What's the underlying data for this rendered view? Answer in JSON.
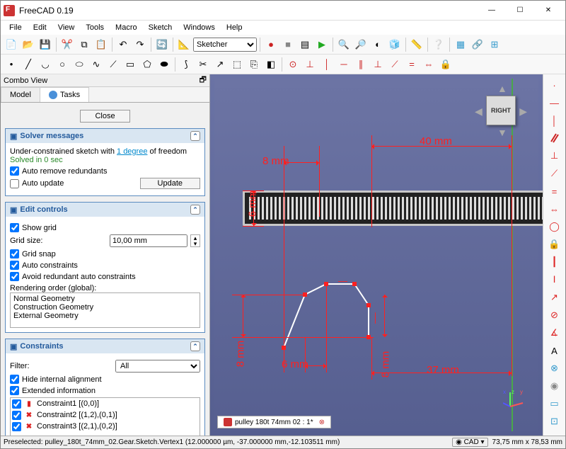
{
  "app": {
    "title": "FreeCAD 0.19"
  },
  "winbuttons": {
    "min": "—",
    "max": "☐",
    "close": "✕"
  },
  "menu": [
    "File",
    "Edit",
    "View",
    "Tools",
    "Macro",
    "Sketch",
    "Windows",
    "Help"
  ],
  "workbench": {
    "selected": "Sketcher",
    "icon_name": "sketcher-icon"
  },
  "combo": {
    "title": "Combo View",
    "tabs": {
      "model": "Model",
      "tasks": "Tasks"
    },
    "close_btn": "Close"
  },
  "solver": {
    "heading": "Solver messages",
    "msg_prefix": "Under-constrained sketch with ",
    "msg_link": "1 degree",
    "msg_suffix": " of freedom",
    "solved": "Solved in 0 sec",
    "auto_remove": "Auto remove redundants",
    "auto_update": "Auto update",
    "update_btn": "Update"
  },
  "edit": {
    "heading": "Edit controls",
    "show_grid": "Show grid",
    "grid_size_label": "Grid size:",
    "grid_size_value": "10,00 mm",
    "grid_snap": "Grid snap",
    "auto_constraints": "Auto constraints",
    "avoid_redundant": "Avoid redundant auto constraints",
    "render_label": "Rendering order (global):",
    "render_items": [
      "Normal Geometry",
      "Construction Geometry",
      "External Geometry"
    ]
  },
  "constraints": {
    "heading": "Constraints",
    "filter_label": "Filter:",
    "filter_value": "All",
    "hide_internal": "Hide internal alignment",
    "extended_info": "Extended information",
    "items": [
      {
        "name": "Constraint1 [(0,0)]",
        "icon": "vert"
      },
      {
        "name": "Constraint2 [(1,2),(0,1)]",
        "icon": "coinc"
      },
      {
        "name": "Constraint3 [(2,1),(0,2)]",
        "icon": "coinc"
      }
    ]
  },
  "dims": {
    "d8mm_top": "8 mm",
    "d40mm": "40 mm",
    "d6mm_v": "6 mm",
    "d8mm_left": "8 mm",
    "d6mm_h": "6 mm",
    "d8mm_right": "8 mm",
    "d37mm": "37 mm"
  },
  "navcube": {
    "face": "RIGHT"
  },
  "doctab": "pulley 180t 74mm 02 : 1*",
  "status": {
    "preselect": "Preselected: pulley_180t_74mm_02.Gear.Sketch.Vertex1 (12.000000 µm, -37.000000 mm,-12.103511 mm)",
    "mode": "CAD",
    "dims": "73,75 mm x 78,53 mm"
  }
}
